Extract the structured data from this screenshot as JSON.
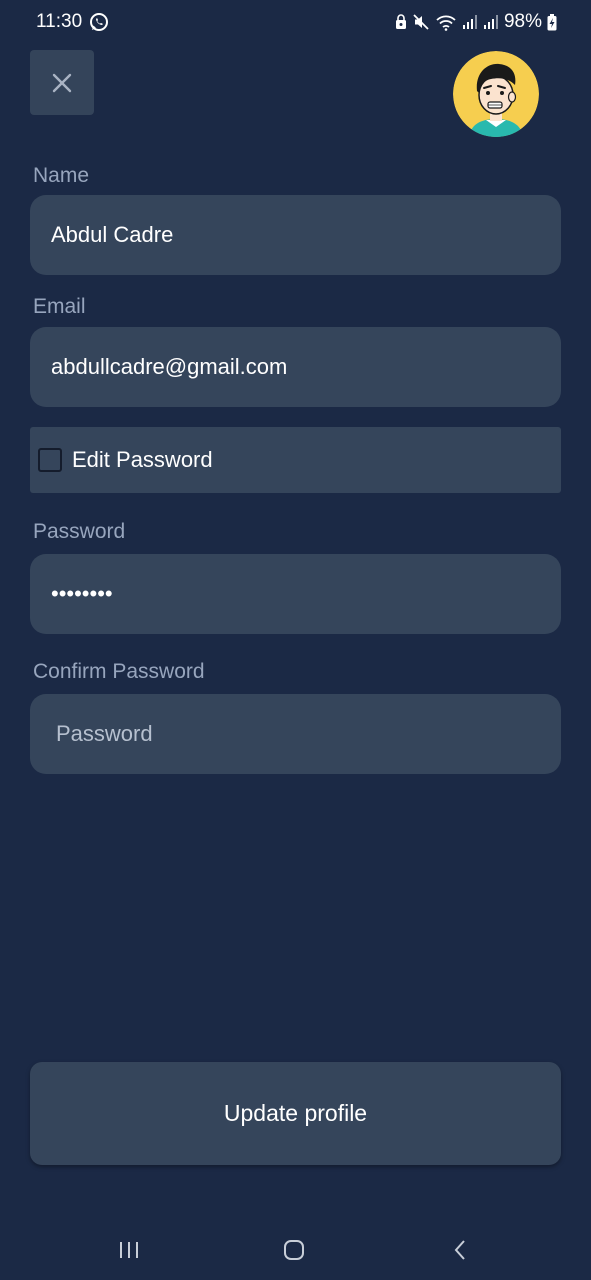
{
  "status_bar": {
    "time": "11:30",
    "battery": "98%"
  },
  "header": {
    "close_icon": "close-icon",
    "avatar_icon": "cartoon-avatar"
  },
  "form": {
    "name": {
      "label": "Name",
      "value": "Abdul Cadre"
    },
    "email": {
      "label": "Email",
      "value": "abdullcadre@gmail.com"
    },
    "edit_password": {
      "label": "Edit Password",
      "checked": false
    },
    "password": {
      "label": "Password",
      "value": "••••••••"
    },
    "confirm_password": {
      "label": "Confirm Password",
      "value": "",
      "placeholder": "Password"
    }
  },
  "actions": {
    "update_label": "Update profile"
  },
  "colors": {
    "background": "#1b2945",
    "surface": "#35455b",
    "label": "#97a5bd",
    "text": "#ffffff"
  }
}
